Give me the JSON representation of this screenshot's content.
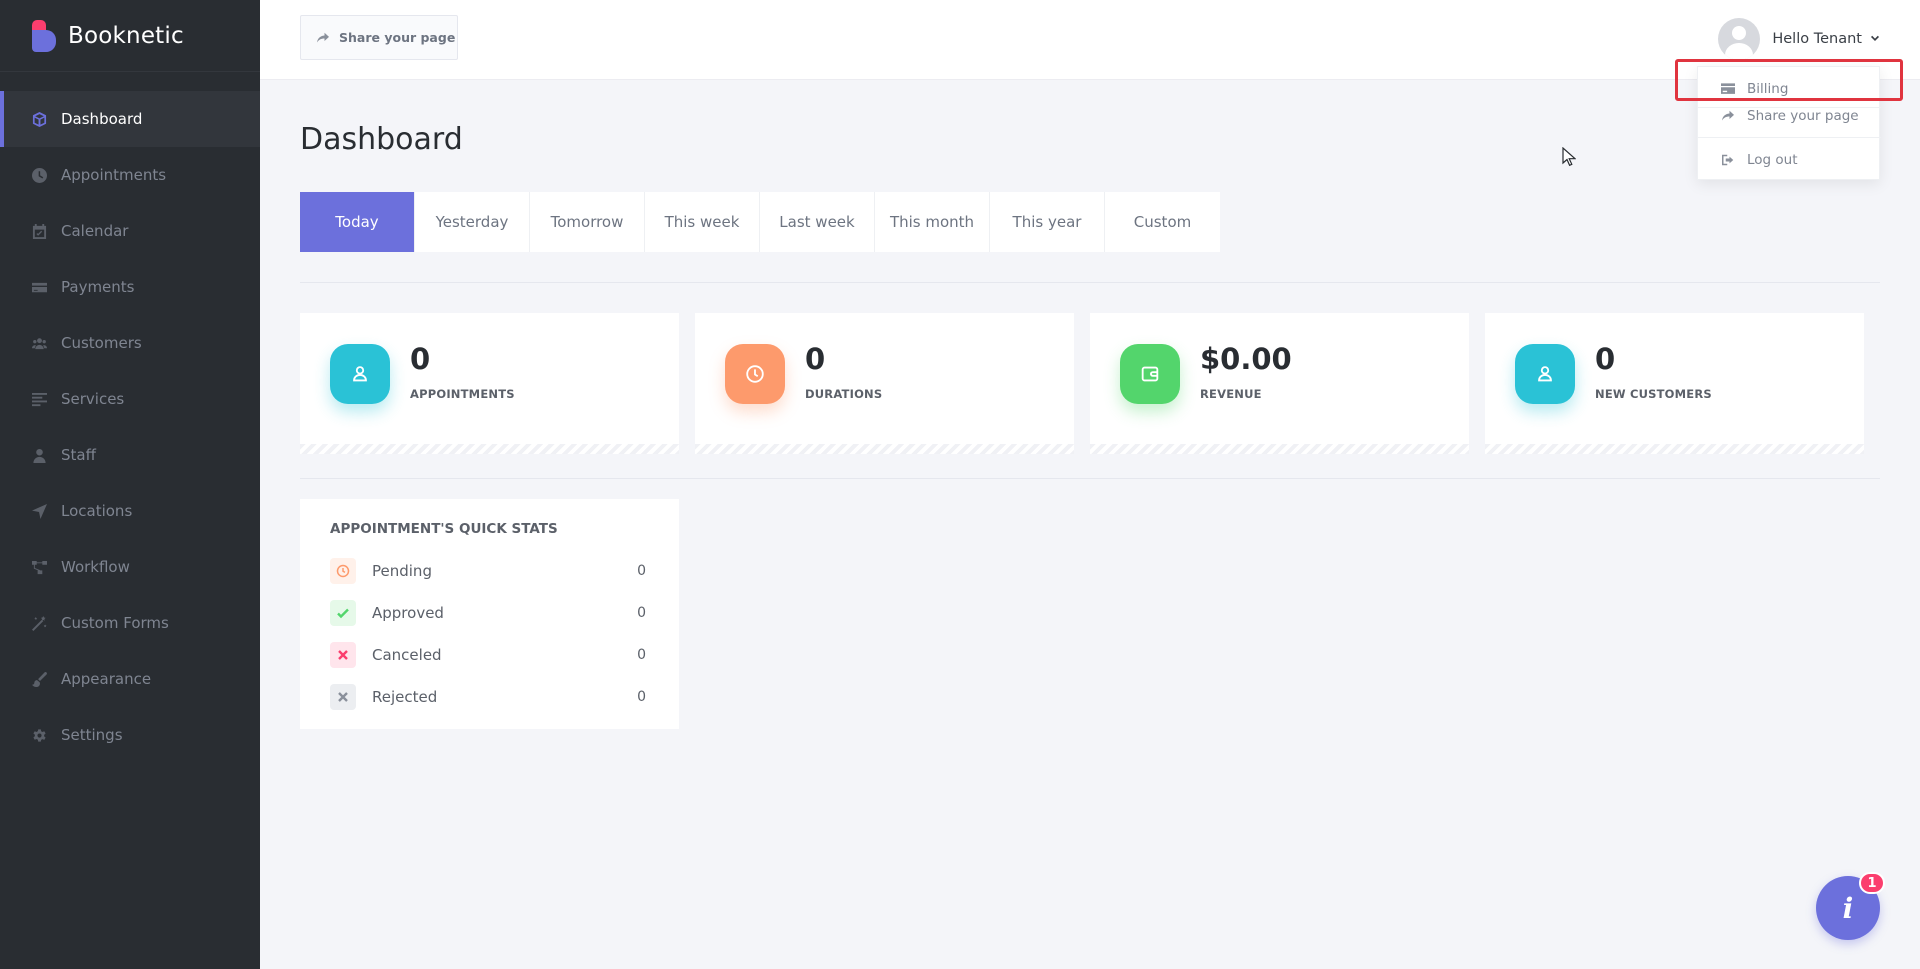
{
  "brand": {
    "name": "Booknetic"
  },
  "sidebar": {
    "items": [
      {
        "label": "Dashboard",
        "icon": "cube-icon",
        "active": true
      },
      {
        "label": "Appointments",
        "icon": "clock-icon"
      },
      {
        "label": "Calendar",
        "icon": "calendar-icon"
      },
      {
        "label": "Payments",
        "icon": "credit-card-icon"
      },
      {
        "label": "Customers",
        "icon": "users-icon"
      },
      {
        "label": "Services",
        "icon": "list-icon"
      },
      {
        "label": "Staff",
        "icon": "user-icon"
      },
      {
        "label": "Locations",
        "icon": "location-arrow-icon"
      },
      {
        "label": "Workflow",
        "icon": "workflow-icon"
      },
      {
        "label": "Custom Forms",
        "icon": "magic-wand-icon"
      },
      {
        "label": "Appearance",
        "icon": "brush-icon"
      },
      {
        "label": "Settings",
        "icon": "gear-icon"
      }
    ]
  },
  "topbar": {
    "share_label": "Share your page",
    "user_greeting": "Hello Tenant"
  },
  "user_menu": {
    "items": [
      {
        "label": "Billing",
        "icon": "credit-card-icon"
      },
      {
        "label": "Share your page",
        "icon": "share-icon"
      },
      {
        "label": "Log out",
        "icon": "logout-icon"
      }
    ]
  },
  "page": {
    "title": "Dashboard"
  },
  "date_tabs": [
    {
      "label": "Today",
      "active": true
    },
    {
      "label": "Yesterday"
    },
    {
      "label": "Tomorrow"
    },
    {
      "label": "This week"
    },
    {
      "label": "Last week"
    },
    {
      "label": "This month"
    },
    {
      "label": "This year"
    },
    {
      "label": "Custom"
    }
  ],
  "stats": [
    {
      "value": "0",
      "label": "APPOINTMENTS",
      "icon": "user-icon",
      "color": "#2ac2d6"
    },
    {
      "value": "0",
      "label": "DURATIONS",
      "icon": "clock-icon",
      "color": "#fd9a6c"
    },
    {
      "value": "$0.00",
      "label": "REVENUE",
      "icon": "wallet-icon",
      "color": "#53d56c"
    },
    {
      "value": "0",
      "label": "NEW CUSTOMERS",
      "icon": "user-icon",
      "color": "#2ac2d6"
    }
  ],
  "quick_stats": {
    "title": "APPOINTMENT'S QUICK STATS",
    "rows": [
      {
        "label": "Pending",
        "count": "0",
        "icon": "clock-icon",
        "color": "#fd9a6c",
        "bg": "#fff1ea"
      },
      {
        "label": "Approved",
        "count": "0",
        "icon": "check-icon",
        "color": "#53d56c",
        "bg": "#e6f9e9"
      },
      {
        "label": "Canceled",
        "count": "0",
        "icon": "close-icon",
        "color": "#fb3e6e",
        "bg": "#ffe5ec"
      },
      {
        "label": "Rejected",
        "count": "0",
        "icon": "close-icon",
        "color": "#8a909b",
        "bg": "#eceef1"
      }
    ]
  },
  "help": {
    "glyph": "i",
    "badge_count": "1"
  },
  "colors": {
    "accent": "#6c70dc",
    "sidebar_bg": "#292d32",
    "danger": "#fb3e6e"
  }
}
